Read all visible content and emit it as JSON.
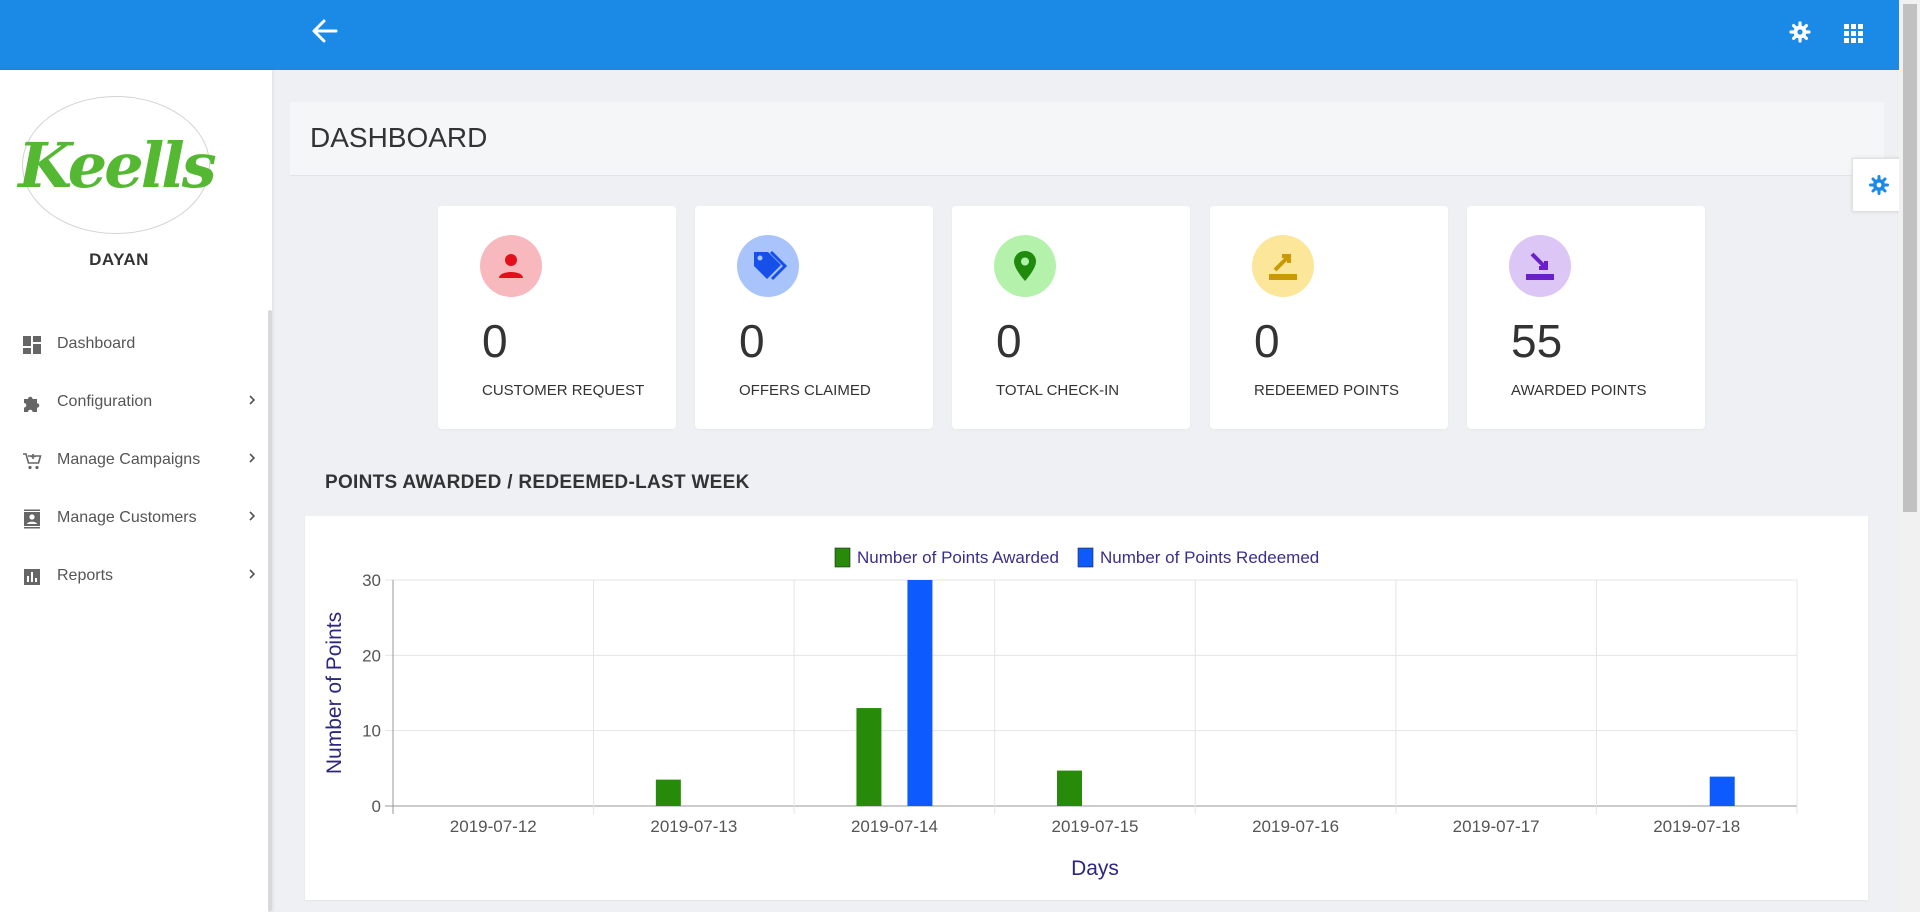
{
  "app": {
    "user_name": "DAYAN",
    "logo_text": "Keells"
  },
  "colors": {
    "topbar": "#1a8ae6",
    "awarded": "#278a08",
    "redeemed": "#0d5bff"
  },
  "topbar": {
    "back_icon": "arrow-left-icon",
    "settings_icon": "gear-icon",
    "apps_icon": "grid-icon"
  },
  "sidebar": {
    "items": [
      {
        "label": "Dashboard",
        "icon": "dashboard-icon",
        "has_children": false
      },
      {
        "label": "Configuration",
        "icon": "puzzle-icon",
        "has_children": true
      },
      {
        "label": "Manage Campaigns",
        "icon": "cart-icon",
        "has_children": true
      },
      {
        "label": "Manage Customers",
        "icon": "contact-card-icon",
        "has_children": true
      },
      {
        "label": "Reports",
        "icon": "bar-chart-icon",
        "has_children": true
      }
    ]
  },
  "page": {
    "title": "DASHBOARD"
  },
  "stats": [
    {
      "value": "0",
      "label": "CUSTOMER REQUEST",
      "icon": "person-icon",
      "bg": "#f7b9bd",
      "fg": "#e3101c"
    },
    {
      "value": "0",
      "label": "OFFERS CLAIMED",
      "icon": "tags-icon",
      "bg": "#a8c4fb",
      "fg": "#1650e8"
    },
    {
      "value": "0",
      "label": "TOTAL CHECK-IN",
      "icon": "location-pin-icon",
      "bg": "#b4f2ac",
      "fg": "#1f8a0c"
    },
    {
      "value": "0",
      "label": "REDEEMED POINTS",
      "icon": "redeem-icon",
      "bg": "#fbe69a",
      "fg": "#c99a06"
    },
    {
      "value": "55",
      "label": "AWARDED POINTS",
      "icon": "award-icon",
      "bg": "#dcc6f6",
      "fg": "#6a1fc8"
    }
  ],
  "chart_section": {
    "title": "POINTS AWARDED / REDEEMED-LAST WEEK"
  },
  "chart_data": {
    "type": "bar",
    "categories": [
      "2019-07-12",
      "2019-07-13",
      "2019-07-14",
      "2019-07-15",
      "2019-07-16",
      "2019-07-17",
      "2019-07-18"
    ],
    "series": [
      {
        "name": "Number of Points Awarded",
        "values": [
          0,
          3.5,
          13,
          4.7,
          0,
          0,
          0
        ]
      },
      {
        "name": "Number of Points Redeemed",
        "values": [
          0,
          0,
          30,
          0,
          0,
          0,
          3.9
        ]
      }
    ],
    "xlabel": "Days",
    "ylabel": "Number of Points",
    "ylim": [
      0,
      30
    ],
    "yticks": [
      0,
      10,
      20,
      30
    ],
    "grid": true,
    "legend": "top-center"
  }
}
